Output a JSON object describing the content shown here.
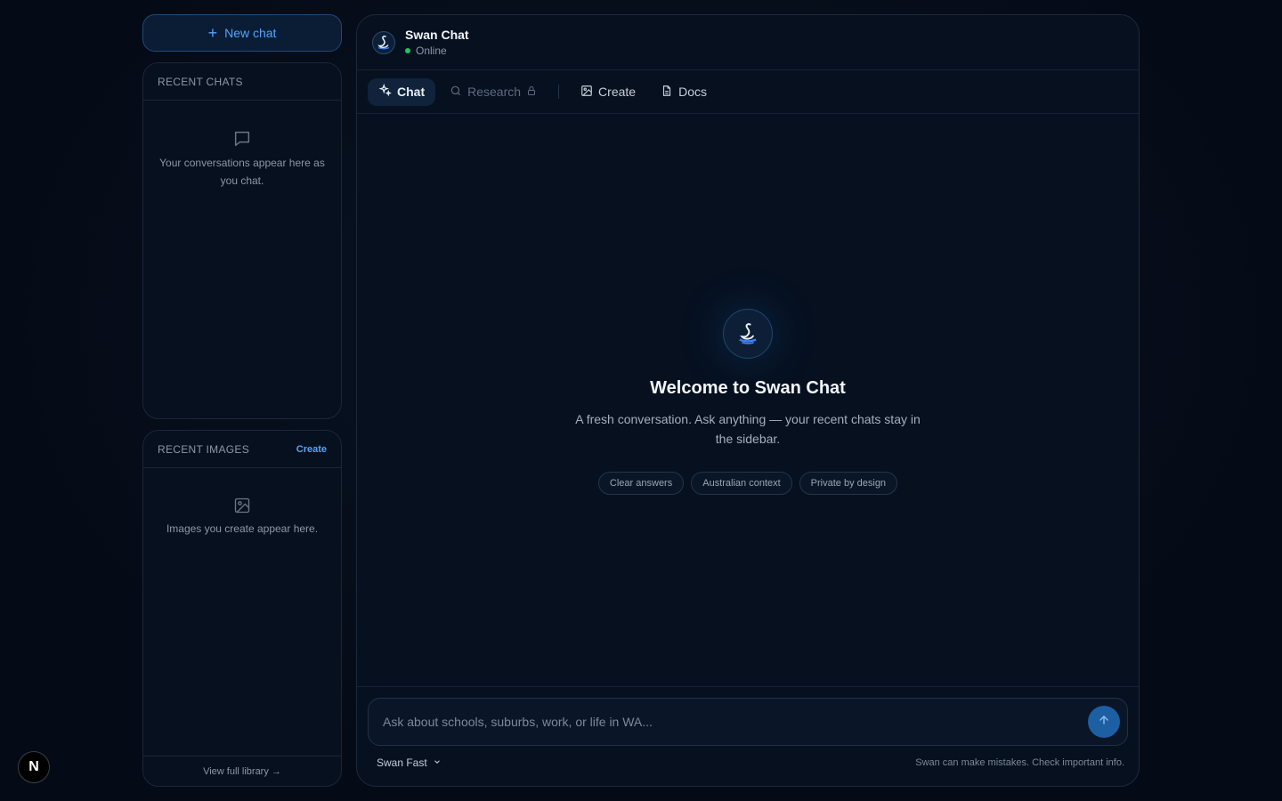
{
  "sidebar": {
    "new_chat_label": "New chat",
    "recent_chats": {
      "heading": "RECENT CHATS",
      "empty_text": "Your conversations appear here as you chat."
    },
    "recent_images": {
      "heading": "RECENT IMAGES",
      "create_label": "Create",
      "empty_text": "Images you create appear here.",
      "footer_link": "View full library →"
    }
  },
  "header": {
    "title": "Swan Chat",
    "status": "Online"
  },
  "tabs": [
    {
      "label": "Chat",
      "icon": "sparkle-icon",
      "active": true
    },
    {
      "label": "Research",
      "icon": "search-icon",
      "locked": true
    },
    {
      "label": "Create",
      "icon": "image-icon"
    },
    {
      "label": "Docs",
      "icon": "document-icon"
    }
  ],
  "welcome": {
    "title": "Welcome to Swan Chat",
    "subtitle": "A fresh conversation. Ask anything — your recent chats stay in the sidebar.",
    "chips": [
      "Clear answers",
      "Australian context",
      "Private by design"
    ]
  },
  "composer": {
    "placeholder": "Ask about schools, suburbs, work, or life in WA...",
    "model": "Swan Fast",
    "disclaimer": "Swan can make mistakes. Check important info."
  },
  "badge": {
    "letter": "N"
  },
  "colors": {
    "accent": "#4ea3ff",
    "online": "#22c55e",
    "send": "#1d5fa3",
    "background": "#050b16"
  }
}
